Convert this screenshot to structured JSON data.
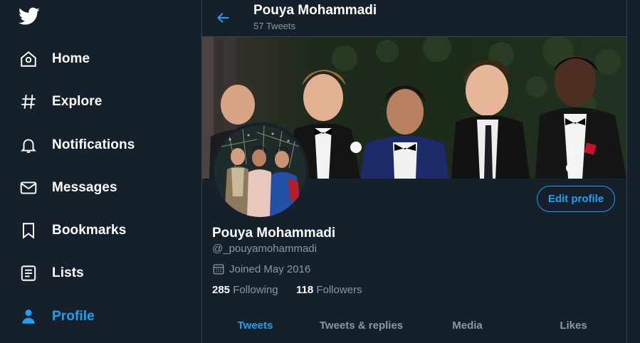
{
  "sidebar": {
    "logo_icon": "twitter-bird-icon",
    "items": [
      {
        "label": "Home",
        "icon": "home-icon"
      },
      {
        "label": "Explore",
        "icon": "hashtag-icon"
      },
      {
        "label": "Notifications",
        "icon": "bell-icon"
      },
      {
        "label": "Messages",
        "icon": "envelope-icon"
      },
      {
        "label": "Bookmarks",
        "icon": "bookmark-icon"
      },
      {
        "label": "Lists",
        "icon": "list-icon"
      },
      {
        "label": "Profile",
        "icon": "person-icon"
      }
    ],
    "active": "Profile"
  },
  "header": {
    "title": "Pouya Mohammadi",
    "subtitle": "57 Tweets"
  },
  "profile": {
    "name": "Pouya Mohammadi",
    "handle": "@_pouyamohammadi",
    "joined": "Joined May 2016",
    "following_count": "285",
    "following_label": "Following",
    "followers_count": "118",
    "followers_label": "Followers",
    "edit_label": "Edit profile"
  },
  "tabs": [
    {
      "label": "Tweets"
    },
    {
      "label": "Tweets & replies"
    },
    {
      "label": "Media"
    },
    {
      "label": "Likes"
    }
  ],
  "colors": {
    "background": "#15202b",
    "accent": "#1da1f2",
    "muted": "#8899a6",
    "border": "#38444d"
  }
}
